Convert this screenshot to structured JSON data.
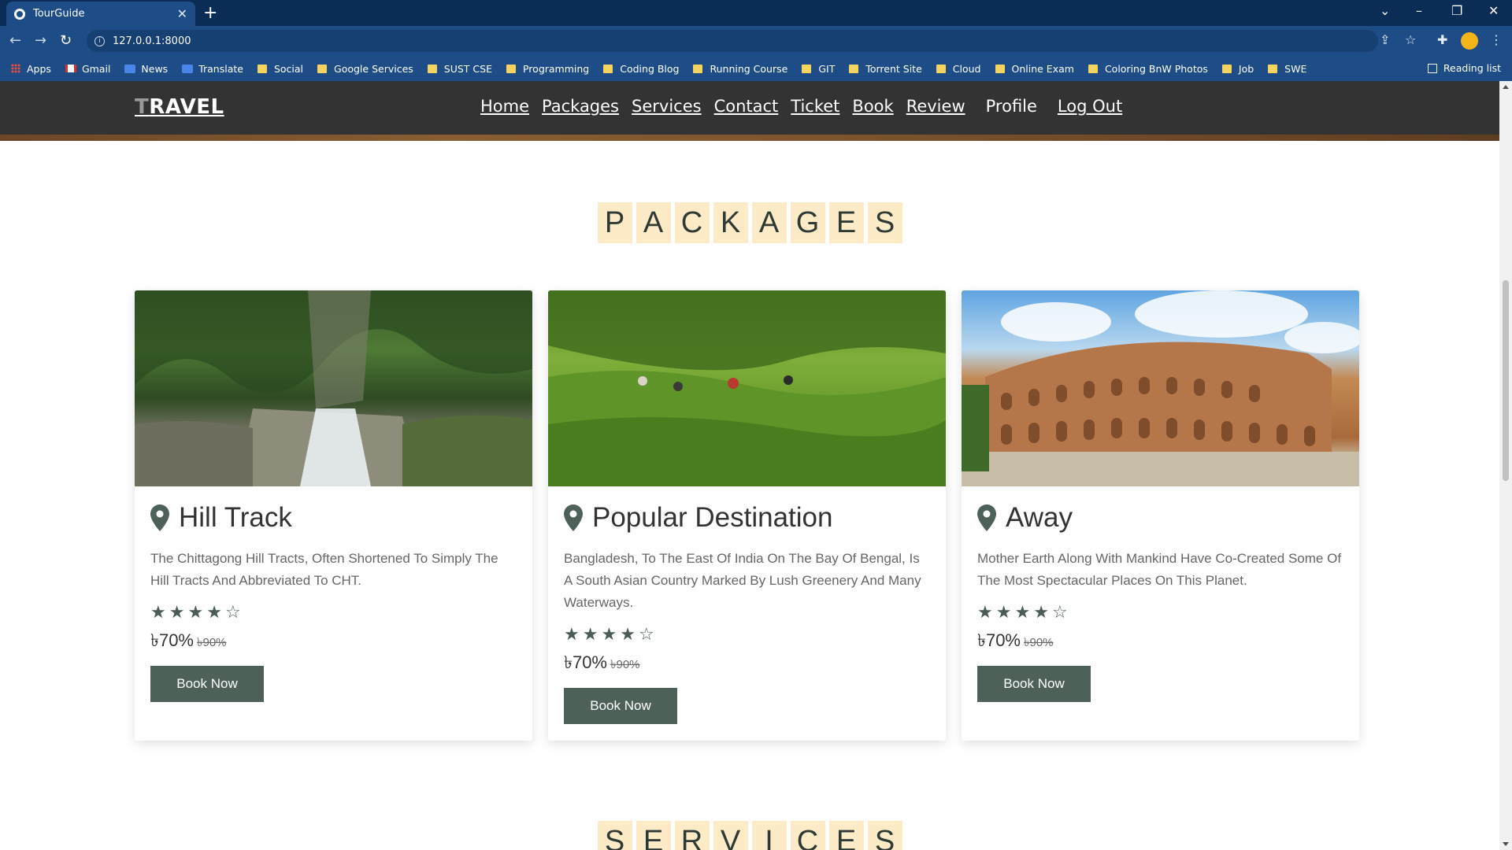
{
  "browser": {
    "tab_title": "TourGuide",
    "url": "127.0.0.1:8000",
    "bookmarks": [
      "Apps",
      "Gmail",
      "News",
      "Translate",
      "Social",
      "Google Services",
      "SUST CSE",
      "Programming",
      "Coding Blog",
      "Running Course",
      "GIT",
      "Torrent Site",
      "Cloud",
      "Online Exam",
      "Coloring BnW Photos",
      "Job",
      "SWE"
    ],
    "reading_list": "Reading list"
  },
  "site": {
    "logo": "TRAVEL",
    "logo_first": "T",
    "logo_rest": "RAVEL",
    "nav": [
      "Home",
      "Packages",
      "Services",
      "Contact",
      "Ticket",
      "Book",
      "Review",
      "Profile",
      "Log Out"
    ]
  },
  "packages_title": [
    "P",
    "A",
    "C",
    "K",
    "A",
    "G",
    "E",
    "S"
  ],
  "services_title": [
    "S",
    "E",
    "R",
    "V",
    "I",
    "C",
    "E",
    "S"
  ],
  "cards": [
    {
      "title": "Hill Track",
      "description": "The Chittagong Hill Tracts, Often Shortened To Simply The Hill Tracts And Abbreviated To CHT.",
      "rating": 4,
      "rating_max": 5,
      "price": "৳70%",
      "old_price": "৳90%",
      "button": "Book Now"
    },
    {
      "title": "Popular Destination",
      "description": "Bangladesh, To The East Of India On The Bay Of Bengal, Is A South Asian Country Marked By Lush Greenery And Many Waterways.",
      "rating": 4,
      "rating_max": 5,
      "price": "৳70%",
      "old_price": "৳90%",
      "button": "Book Now"
    },
    {
      "title": "Away",
      "description": "Mother Earth Along With Mankind Have Co-Created Some Of The Most Spectacular Places On This Planet.",
      "rating": 4,
      "rating_max": 5,
      "price": "৳70%",
      "old_price": "৳90%",
      "button": "Book Now"
    }
  ],
  "icons": {
    "location": "map-pin-icon",
    "star_filled": "star-icon",
    "star_empty": "star-outline-icon"
  },
  "colors": {
    "header_bg": "#333333",
    "button_bg": "#4d6159",
    "title_letter_bg": "#fdebc8"
  }
}
